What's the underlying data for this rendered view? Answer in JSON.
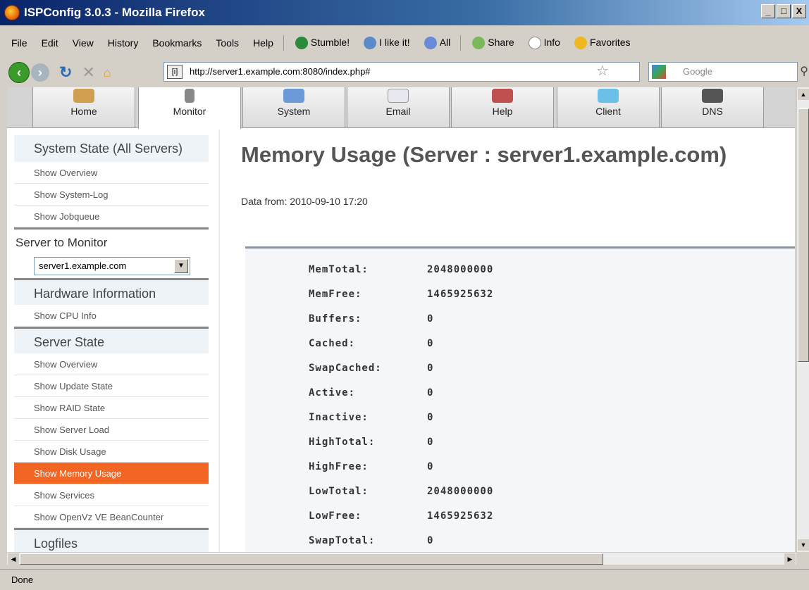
{
  "window": {
    "title": "ISPConfig 3.0.3 - Mozilla Firefox",
    "buttons": [
      "_",
      "□",
      "X"
    ]
  },
  "menubar": {
    "items": [
      "File",
      "Edit",
      "View",
      "History",
      "Bookmarks",
      "Tools",
      "Help"
    ],
    "toolbar": [
      "Stumble!",
      "I like it!",
      "All",
      "Share",
      "Info",
      "Favorites"
    ]
  },
  "nav": {
    "url": "http://server1.example.com:8080/index.php#",
    "search_placeholder": "Google"
  },
  "tabs": [
    {
      "label": "Home",
      "icon": "home-icon"
    },
    {
      "label": "Monitor",
      "icon": "monitor-icon"
    },
    {
      "label": "System",
      "icon": "system-icon"
    },
    {
      "label": "Email",
      "icon": "email-icon"
    },
    {
      "label": "Help",
      "icon": "help-icon"
    },
    {
      "label": "Client",
      "icon": "client-icon"
    },
    {
      "label": "DNS",
      "icon": "dns-icon"
    }
  ],
  "sidebar": {
    "system_state": {
      "heading": "System State (All Servers)",
      "items": [
        "Show Overview",
        "Show System-Log",
        "Show Jobqueue"
      ]
    },
    "server_to_monitor": {
      "label": "Server to Monitor",
      "selected": "server1.example.com"
    },
    "hardware": {
      "heading": "Hardware Information",
      "items": [
        "Show CPU Info"
      ]
    },
    "server_state": {
      "heading": "Server State",
      "items": [
        "Show Overview",
        "Show Update State",
        "Show RAID State",
        "Show Server Load",
        "Show Disk Usage",
        "Show Memory Usage",
        "Show Services",
        "Show OpenVz VE BeanCounter"
      ],
      "active": "Show Memory Usage"
    },
    "logfiles": {
      "heading": "Logfiles"
    }
  },
  "main": {
    "title": "Memory Usage (Server : server1.example.com)",
    "data_from": "Data from: 2010-09-10 17:20",
    "rows": [
      {
        "key": "MemTotal:",
        "value": "2048000000"
      },
      {
        "key": "MemFree:",
        "value": "1465925632"
      },
      {
        "key": "Buffers:",
        "value": "0"
      },
      {
        "key": "Cached:",
        "value": "0"
      },
      {
        "key": "SwapCached:",
        "value": "0"
      },
      {
        "key": "Active:",
        "value": "0"
      },
      {
        "key": "Inactive:",
        "value": "0"
      },
      {
        "key": "HighTotal:",
        "value": "0"
      },
      {
        "key": "HighFree:",
        "value": "0"
      },
      {
        "key": "LowTotal:",
        "value": "2048000000"
      },
      {
        "key": "LowFree:",
        "value": "1465925632"
      },
      {
        "key": "SwapTotal:",
        "value": "0"
      }
    ]
  },
  "status": {
    "text": "Done"
  },
  "colors": {
    "accent": "#f26522",
    "title_bar": "#0a246a"
  }
}
